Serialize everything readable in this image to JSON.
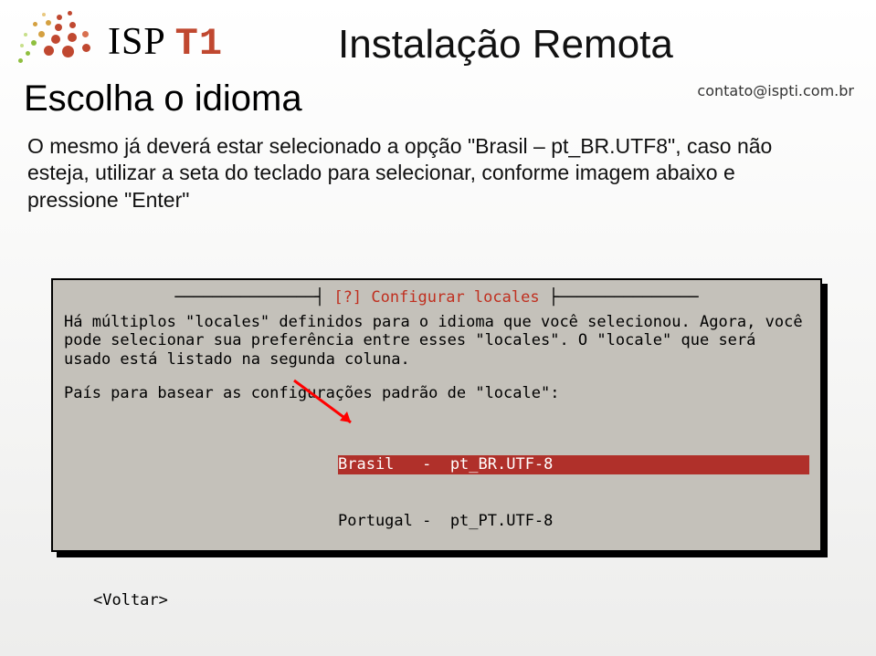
{
  "brand": {
    "isp": "ISP ",
    "t1": "T1"
  },
  "title": "Instalação Remota",
  "contact": "contato@ispti.com.br",
  "section_title": "Escolha o idioma",
  "body_text": "O mesmo já deverá estar selecionado a opção \"Brasil – pt_BR.UTF8\", caso não esteja, utilizar a seta do teclado para selecionar, conforme imagem abaixo e pressione \"Enter\"",
  "terminal": {
    "dialog_title": "[?] Configurar locales",
    "para1": "Há múltiplos \"locales\" definidos para o idioma que você selecionou. Agora, você pode selecionar sua preferência entre esses \"locales\". O \"locale\" que será usado está listado na segunda coluna.",
    "para2": "País para basear as configurações padrão de \"locale\":",
    "options": [
      {
        "label": "Brasil   -  pt_BR.UTF-8",
        "selected": true
      },
      {
        "label": "Portugal -  pt_PT.UTF-8",
        "selected": false
      }
    ],
    "back": "<Voltar>"
  }
}
